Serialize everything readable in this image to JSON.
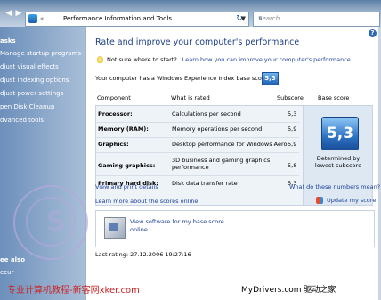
{
  "address": {
    "crumb": "«",
    "path": "Performance Information and Tools",
    "search_placeholder": "Search"
  },
  "sidebar": {
    "heading": "asks",
    "items": [
      {
        "label": "Manage startup programs"
      },
      {
        "label": "djust visual effects"
      },
      {
        "label": "djust indexing options"
      },
      {
        "label": "djust power settings"
      },
      {
        "label": "pen Disk Cleanup"
      },
      {
        "label": "dvanced tools"
      }
    ],
    "see_also": "ee also",
    "security": "ecur"
  },
  "main": {
    "title": "Rate and improve your computer's performance",
    "tip_label": "Not sure where to start?",
    "tip_link": "Learn how you can improve your computer's performance.",
    "base_text": "Your computer has a Windows Experience Index base score of",
    "base_score": "5,3",
    "headers": {
      "component": "Component",
      "rated": "What is rated",
      "subscore": "Subscore",
      "basescore": "Base score"
    },
    "rows": [
      {
        "component": "Processor:",
        "rated": "Calculations per second",
        "score": "5,3"
      },
      {
        "component": "Memory (RAM):",
        "rated": "Memory operations per second",
        "score": "5,9"
      },
      {
        "component": "Graphics:",
        "rated": "Desktop performance for Windows Aero",
        "score": "5,9"
      },
      {
        "component": "Gaming graphics:",
        "rated": "3D business and gaming graphics performance",
        "score": "5,8"
      },
      {
        "component": "Primary hard disk:",
        "rated": "Disk data transfer rate",
        "score": "5,3"
      }
    ],
    "determined": "Determined by lowest subscore",
    "view_print": "View and print details",
    "what_mean": "What do these numbers mean?",
    "learn_more": "Learn more about the scores online",
    "update": "Update my score",
    "software": "View software for my base score online",
    "last_rating": "Last rating: 27.12.2006 19:27:16"
  },
  "watermark": {
    "left": "专业计算机教程-新客网xker.com",
    "right": "MyDrivers.com 驱动之家"
  }
}
